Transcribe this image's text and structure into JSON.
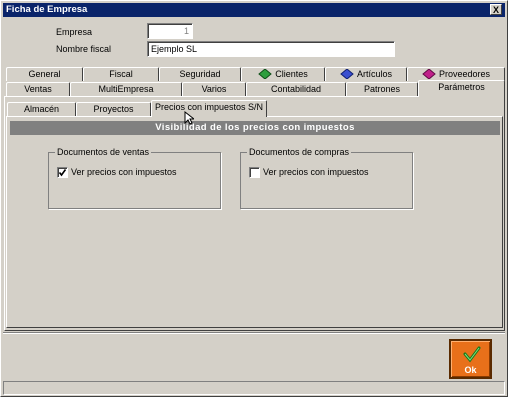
{
  "window": {
    "title": "Ficha de Empresa",
    "close_label": "X"
  },
  "form": {
    "empresa_label": "Empresa",
    "empresa_value": "1",
    "nombre_label": "Nombre fiscal",
    "nombre_value": "Ejemplo SL"
  },
  "tabs_row1": [
    "General",
    "Fiscal",
    "Seguridad",
    "Clientes",
    "Artículos",
    "Proveedores"
  ],
  "tabs_row2": [
    "Ventas",
    "MultiEmpresa",
    "Varios",
    "Contabilidad",
    "Patrones",
    "Parámetros"
  ],
  "subtabs": [
    "Almacén",
    "Proyectos",
    "Precios con impuestos S/N"
  ],
  "banner": "Visibilidad de los precios con impuestos",
  "groups": {
    "ventas": {
      "title": "Documentos de ventas",
      "option": "Ver precios con impuestos",
      "checked": true
    },
    "compras": {
      "title": "Documentos de compras",
      "option": "Ver precios con impuestos",
      "checked": false
    }
  },
  "ok_button": {
    "label": "Ok"
  },
  "colors": {
    "titlebar": "#0a246a",
    "banner": "#808080",
    "ok": "#e8701a",
    "clientes_icon": "#2e9e3e",
    "articulos_icon": "#3a4fd0",
    "proveedores_icon": "#c0208a"
  }
}
